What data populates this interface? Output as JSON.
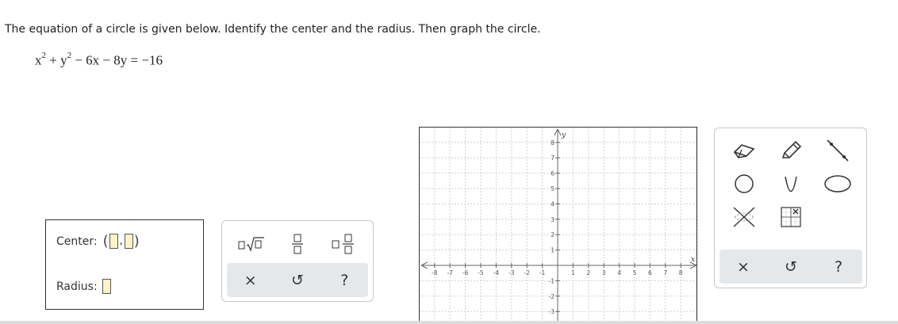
{
  "question": {
    "text": "The equation of a circle is given below. Identify the center and the radius. Then graph the circle."
  },
  "equation": {
    "x_var": "x",
    "plus": "+",
    "y_var": "y",
    "exp": "2",
    "rest": "− 6x − 8y = −16"
  },
  "answer": {
    "center_label": "Center:",
    "radius_label": "Radius:",
    "comma": ","
  },
  "palette": {
    "top_icons": [
      "sqrt-template-icon",
      "fraction-template-icon",
      "mixed-number-template-icon"
    ],
    "clear_label": "×",
    "undo_label": "↺",
    "help_label": "?"
  },
  "graph": {
    "x_label": "x",
    "y_label": "y",
    "x_ticks": [
      "-8",
      "-7",
      "-6",
      "-5",
      "-4",
      "-3",
      "-2",
      "-1",
      "1",
      "2",
      "3",
      "4",
      "5",
      "6",
      "7",
      "8"
    ],
    "y_ticks": [
      "8",
      "7",
      "6",
      "5",
      "4",
      "3",
      "2",
      "1",
      "-1",
      "-2",
      "-3"
    ]
  },
  "tools": {
    "icons": [
      "eraser-icon",
      "pencil-icon",
      "line-icon",
      "circle-icon",
      "parabola-icon",
      "ellipse-icon",
      "no-solution-icon",
      "grid-area-icon"
    ],
    "clear_label": "×",
    "undo_label": "↺",
    "help_label": "?",
    "accent": "#333333"
  }
}
